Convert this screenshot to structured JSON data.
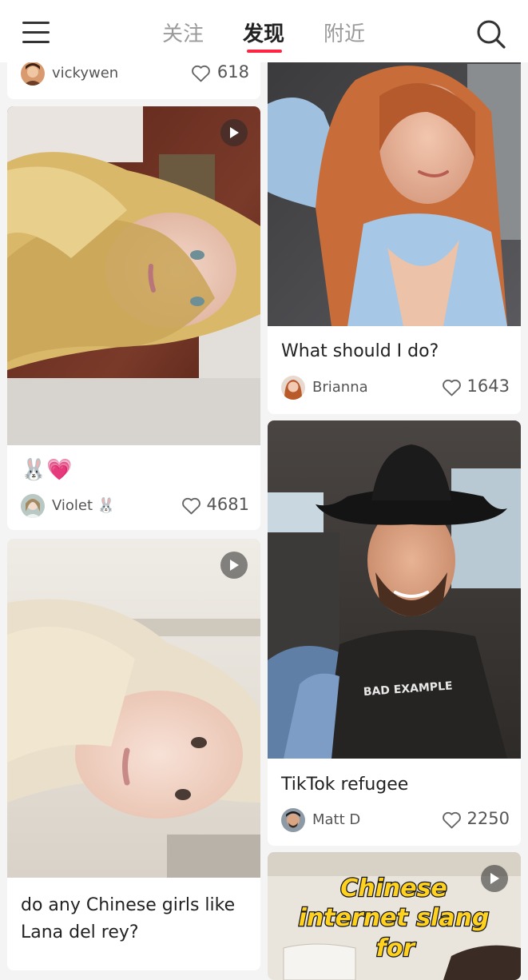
{
  "header": {
    "tabs": [
      {
        "label": "关注",
        "active": false
      },
      {
        "label": "发现",
        "active": true
      },
      {
        "label": "附近",
        "active": false
      }
    ],
    "accent_color": "#ff2442",
    "menu_icon": "hamburger-menu-icon",
    "search_icon": "search-icon"
  },
  "feed": {
    "left": [
      {
        "author": "vickywen",
        "likes": "618",
        "title": ""
      },
      {
        "title": "🐰💗",
        "author": "Violet 🐰",
        "likes": "4681",
        "is_video": true
      },
      {
        "title": "do any Chinese girls like Lana del rey?",
        "is_video": true
      }
    ],
    "right": [
      {
        "title": "What should I do?",
        "author": "Brianna",
        "likes": "1643"
      },
      {
        "title": "TikTok refugee",
        "author": "Matt D",
        "likes": "2250",
        "image_text": "BAD EXAMPLE"
      },
      {
        "image_text_1": "Chinese",
        "image_text_2": "internet slang",
        "image_text_3": "for",
        "is_video": true
      }
    ]
  }
}
